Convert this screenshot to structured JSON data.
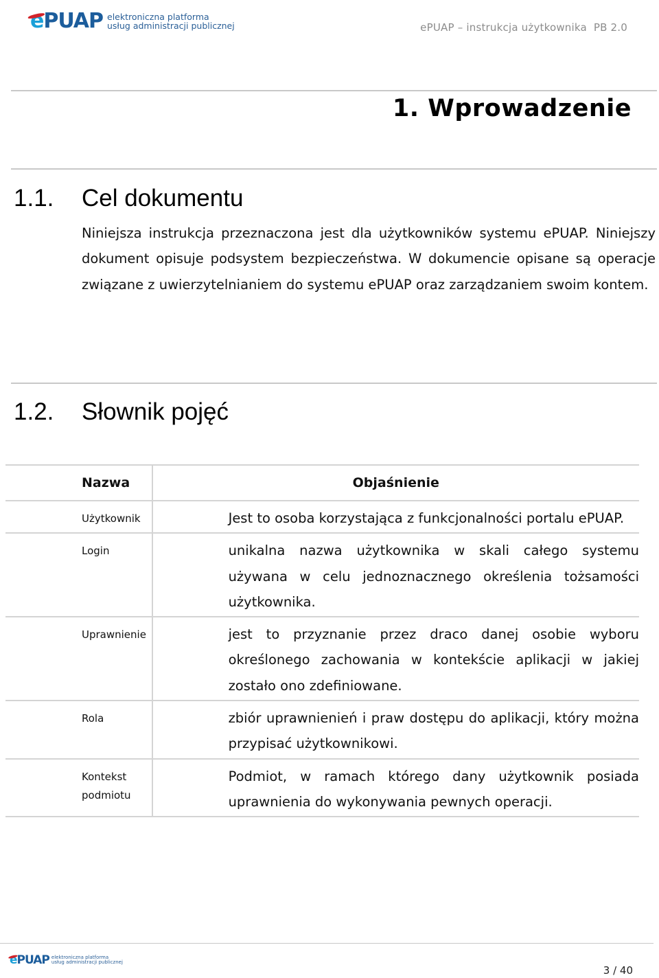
{
  "header": {
    "logo": {
      "mark_e": "e",
      "mark_rest": "PUAP",
      "tagline_line1": "elektroniczna platforma",
      "tagline_line2": "usług administracji publicznej"
    },
    "doc_title": "ePUAP – instrukcja użytkownika  PB 2.0"
  },
  "chapter": {
    "title": "1. Wprowadzenie"
  },
  "sections": [
    {
      "number": "1.1.",
      "title": "Cel dokumentu",
      "paragraph": "Niniejsza instrukcja przeznaczona jest dla użytkowników systemu ePUAP. Niniejszy dokument opisuje podsystem bezpieczeństwa. W dokumencie opisane są operacje związane z uwierzytelnianiem do systemu ePUAP oraz zarządzaniem swoim kontem."
    },
    {
      "number": "1.2.",
      "title": "Słownik pojęć"
    }
  ],
  "glossary": {
    "headers": [
      "Nazwa",
      "Objaśnienie"
    ],
    "rows": [
      {
        "term": "Użytkownik",
        "definition": "Jest to osoba korzystająca z funkcjonalności portalu ePUAP."
      },
      {
        "term": "Login",
        "definition": "unikalna nazwa użytkownika w skali całego systemu używana w celu jednoznacznego określenia tożsamości użytkownika."
      },
      {
        "term": "Uprawnienie",
        "definition": "jest to przyznanie przez draco danej osobie wyboru określonego zachowania w kontekście aplikacji w jakiej zostało ono zdefiniowane."
      },
      {
        "term": "Rola",
        "definition": "zbiór uprawnienień i praw dostępu do aplikacji, który można przypisać użytkownikowi."
      },
      {
        "term": "Kontekst podmiotu",
        "definition": "Podmiot, w ramach którego dany użytkownik posiada uprawnienia do wykonywania pewnych operacji."
      }
    ]
  },
  "footer": {
    "logo": {
      "mark_e": "e",
      "mark_rest": "PUAP",
      "tagline_line1": "elektroniczna platforma",
      "tagline_line2": "usług administracji publicznej"
    },
    "page_number": "3 / 40"
  },
  "colors": {
    "logo_e": "#1aa0d8",
    "logo_puap": "#1c5d9c",
    "logo_swoosh": "#d2232a",
    "rule": "#c8c8c8",
    "doc_title": "#8c8c8c"
  }
}
